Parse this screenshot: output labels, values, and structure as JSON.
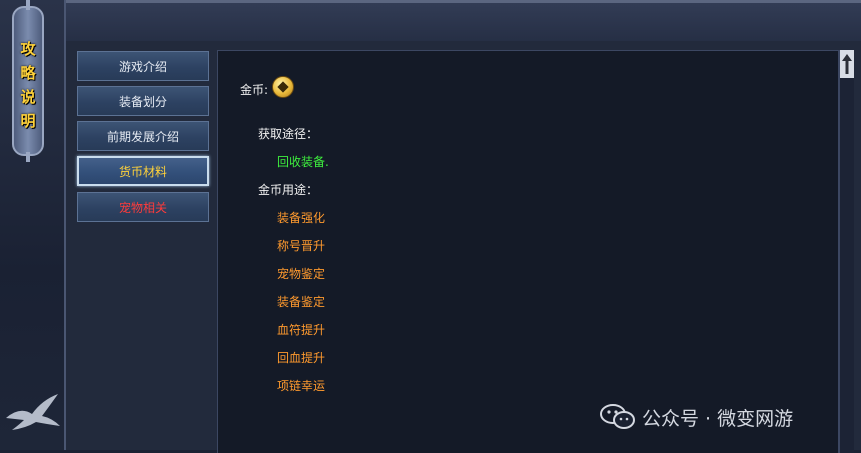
{
  "sidebar_banner": {
    "chars": [
      "攻",
      "略",
      "说",
      "明"
    ]
  },
  "tabs": [
    {
      "label": "游戏介绍",
      "active": false
    },
    {
      "label": "装备划分",
      "active": false
    },
    {
      "label": "前期发展介绍",
      "active": false
    },
    {
      "label": "货币材料",
      "active": true
    },
    {
      "label": "宠物相关",
      "active": false,
      "color": "#ff3b3b"
    }
  ],
  "content": {
    "currency_label": "金币:",
    "currency_icon": "gold-coin-icon",
    "obtain_heading": "获取途径：",
    "obtain_items": [
      "回收装备."
    ],
    "usage_heading": "金币用途：",
    "usage_items": [
      "装备强化",
      "称号晋升",
      "宠物鉴定",
      "装备鉴定",
      "血符提升",
      "回血提升",
      "项链幸运"
    ]
  },
  "watermark": {
    "text": "公众号 · 微变网游",
    "icon": "wechat-icon"
  },
  "colors": {
    "heading": "#f1f1f1",
    "obtain": "#3ef03e",
    "usage": "#ff9a2e",
    "active_tab_text": "#ffd23a",
    "banner_text": "#ffd23a"
  }
}
